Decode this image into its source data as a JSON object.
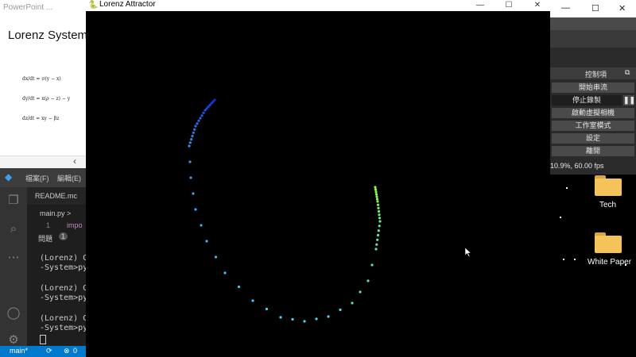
{
  "powerpoint": {
    "title": "PowerPoint ...",
    "slide_heading": "Lorenz System",
    "equations": [
      "dx/dt = σ(y − x)",
      "dy/dt = x(ρ − z) − y",
      "dz/dt = xy − βz"
    ],
    "collapse_icon": "chevron-left-icon"
  },
  "vscode": {
    "menu": [
      "檔案(F)",
      "編輯(E)"
    ],
    "tabs": [
      "README.mc",
      "main.py >"
    ],
    "code_line_number": "1",
    "code_text": "impo",
    "panel_tab": "問題",
    "panel_badge": "1",
    "terminal_lines": [
      "(Lorenz) C:",
      "-System>pyt",
      "(Lorenz) C:",
      "-System>pyt",
      "(Lorenz) C:",
      "-System>pyt"
    ],
    "status": {
      "branch": "main*",
      "errors": "0"
    }
  },
  "lorenz_window": {
    "title": "Lorenz Attractor",
    "buttons": [
      "—",
      "☐",
      "✕"
    ]
  },
  "obs": {
    "window_buttons": [
      "—",
      "☐",
      "✕"
    ],
    "controls_header": "控制項",
    "buttons": [
      "開始串流",
      "停止錄製",
      "啟動虛擬相機",
      "工作室模式",
      "設定",
      "離開"
    ],
    "pause_icon": "pause-icon",
    "status": "10.9%, 60.00 fps"
  },
  "desktop": {
    "icons": [
      {
        "label": "Tech",
        "icon": "folder-icon"
      },
      {
        "label": "White Paper",
        "icon": "folder-icon"
      }
    ]
  },
  "colors": {
    "trail_start": "#1a2bd6",
    "trail_mid": "#3fd2ff",
    "trail_end": "#86ff2e"
  }
}
